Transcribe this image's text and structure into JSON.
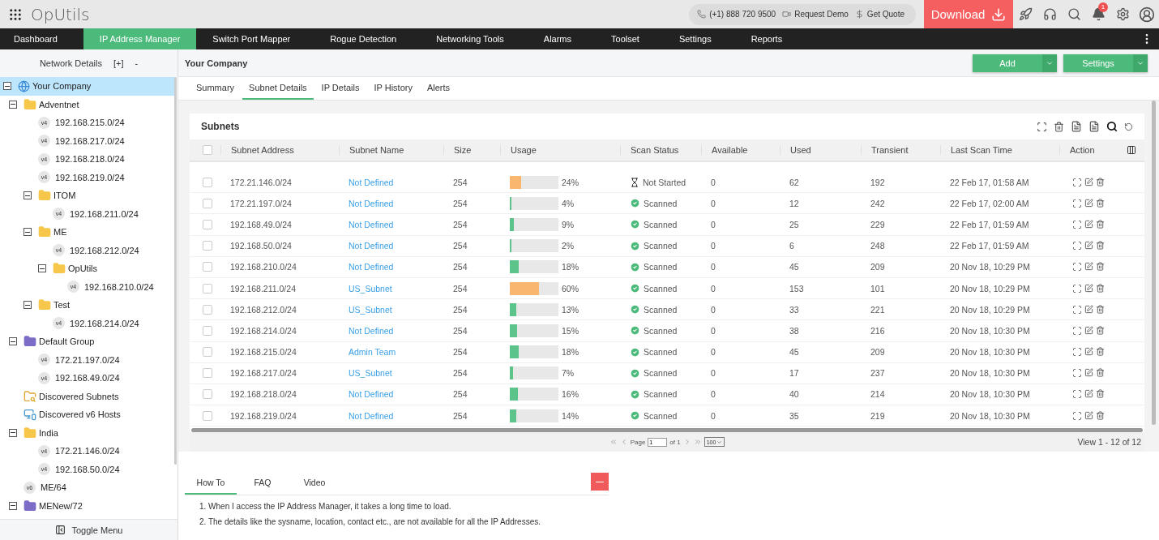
{
  "header": {
    "app_name": "OpUtils",
    "phone": "(+1) 888 720 9500",
    "request_demo": "Request Demo",
    "get_quote": "Get Quote",
    "download": "Download",
    "notifications": "1"
  },
  "nav": {
    "items": [
      {
        "label": "Dashboard",
        "selected": false
      },
      {
        "label": "IP Address Manager",
        "selected": true
      },
      {
        "label": "Switch Port Mapper",
        "selected": false
      },
      {
        "label": "Rogue Detection",
        "selected": false
      },
      {
        "label": "Networking Tools",
        "selected": false
      },
      {
        "label": "Alarms",
        "selected": false
      },
      {
        "label": "Toolset",
        "selected": false
      },
      {
        "label": "Settings",
        "selected": false
      },
      {
        "label": "Reports",
        "selected": false
      }
    ]
  },
  "sidebar": {
    "title": "Network Details",
    "expand_all": "[+]",
    "collapse_all": "-",
    "toggle_menu": "Toggle Menu",
    "tree": [
      {
        "label": "Your Company",
        "kind": "root",
        "expanded": true,
        "selected": true,
        "children": [
          {
            "label": "Adventnet",
            "kind": "folder",
            "color": "#f6c74a",
            "expanded": true,
            "selected": false,
            "children": [
              {
                "label": "192.168.215.0/24",
                "kind": "subnet",
                "badge": "v4",
                "selected": false
              },
              {
                "label": "192.168.217.0/24",
                "kind": "subnet",
                "badge": "v4",
                "selected": false
              },
              {
                "label": "192.168.218.0/24",
                "kind": "subnet",
                "badge": "v4",
                "selected": false
              },
              {
                "label": "192.168.219.0/24",
                "kind": "subnet",
                "badge": "v4",
                "selected": false
              },
              {
                "label": "ITOM",
                "kind": "folder",
                "color": "#f6c74a",
                "expanded": true,
                "selected": false,
                "children": [
                  {
                    "label": "192.168.211.0/24",
                    "kind": "subnet",
                    "badge": "v4",
                    "selected": false
                  }
                ]
              },
              {
                "label": "ME",
                "kind": "folder",
                "color": "#f6c74a",
                "expanded": true,
                "selected": false,
                "children": [
                  {
                    "label": "192.168.212.0/24",
                    "kind": "subnet",
                    "badge": "v4",
                    "selected": false
                  },
                  {
                    "label": "OpUtils",
                    "kind": "folder",
                    "color": "#f6c74a",
                    "expanded": true,
                    "selected": false,
                    "children": [
                      {
                        "label": "192.168.210.0/24",
                        "kind": "subnet",
                        "badge": "v4",
                        "selected": false
                      }
                    ]
                  }
                ]
              },
              {
                "label": "Test",
                "kind": "folder",
                "color": "#f6c74a",
                "expanded": true,
                "selected": false,
                "children": [
                  {
                    "label": "192.168.214.0/24",
                    "kind": "subnet",
                    "badge": "v4",
                    "selected": false
                  }
                ]
              }
            ]
          },
          {
            "label": "Default Group",
            "kind": "folder",
            "color": "#7c6cc6",
            "expanded": true,
            "selected": false,
            "children": [
              {
                "label": "172.21.197.0/24",
                "kind": "subnet",
                "badge": "v4",
                "selected": false
              },
              {
                "label": "192.168.49.0/24",
                "kind": "subnet",
                "badge": "v4",
                "selected": false
              }
            ]
          },
          {
            "label": "Discovered Subnets",
            "kind": "discovery",
            "selected": false
          },
          {
            "label": "Discovered v6 Hosts",
            "kind": "discovery-v6",
            "selected": false
          },
          {
            "label": "India",
            "kind": "folder",
            "color": "#f6c74a",
            "expanded": true,
            "selected": false,
            "children": [
              {
                "label": "172.21.146.0/24",
                "kind": "subnet",
                "badge": "v4",
                "selected": false
              },
              {
                "label": "192.168.50.0/24",
                "kind": "subnet",
                "badge": "v4",
                "selected": false
              }
            ]
          },
          {
            "label": "ME/64",
            "kind": "subnet",
            "badge": "v6",
            "selected": false
          },
          {
            "label": "MENew/72",
            "kind": "folder",
            "color": "#7c6cc6",
            "expanded": true,
            "selected": false
          }
        ]
      }
    ]
  },
  "breadcrumb": "Your Company",
  "actions": {
    "add": "Add",
    "settings": "Settings"
  },
  "tabs": [
    {
      "label": "Summary",
      "selected": false
    },
    {
      "label": "Subnet Details",
      "selected": true
    },
    {
      "label": "IP Details",
      "selected": false
    },
    {
      "label": "IP History",
      "selected": false
    },
    {
      "label": "Alerts",
      "selected": false
    }
  ],
  "table": {
    "title": "Subnets",
    "select_all": {
      "checked": false
    },
    "columns": [
      "Subnet Address",
      "Subnet Name",
      "Size",
      "Usage",
      "Scan Status",
      "Available",
      "Used",
      "Transient",
      "Last Scan Time",
      "Action"
    ],
    "rows": [
      {
        "checked": false,
        "address": "172.21.146.0/24",
        "name": "Not Defined",
        "size": "254",
        "usage": {
          "level": 0.24,
          "text": "24%",
          "color": "#f8b66e"
        },
        "status": {
          "kind": "not-started",
          "text": "Not Started"
        },
        "available": "0",
        "used": "62",
        "transient": "192",
        "last_scan": "22 Feb 17, 01:58 AM"
      },
      {
        "checked": false,
        "address": "172.21.197.0/24",
        "name": "Not Defined",
        "size": "254",
        "usage": {
          "level": 0.04,
          "text": "4%",
          "color": "#5cc38a"
        },
        "status": {
          "kind": "scanned",
          "text": "Scanned"
        },
        "available": "0",
        "used": "12",
        "transient": "242",
        "last_scan": "22 Feb 17, 02:00 AM"
      },
      {
        "checked": false,
        "address": "192.168.49.0/24",
        "name": "Not Defined",
        "size": "254",
        "usage": {
          "level": 0.09,
          "text": "9%",
          "color": "#5cc38a"
        },
        "status": {
          "kind": "scanned",
          "text": "Scanned"
        },
        "available": "0",
        "used": "25",
        "transient": "229",
        "last_scan": "22 Feb 17, 01:59 AM"
      },
      {
        "checked": false,
        "address": "192.168.50.0/24",
        "name": "Not Defined",
        "size": "254",
        "usage": {
          "level": 0.02,
          "text": "2%",
          "color": "#5cc38a"
        },
        "status": {
          "kind": "scanned",
          "text": "Scanned"
        },
        "available": "0",
        "used": "6",
        "transient": "248",
        "last_scan": "22 Feb 17, 01:59 AM"
      },
      {
        "checked": false,
        "address": "192.168.210.0/24",
        "name": "Not Defined",
        "size": "254",
        "usage": {
          "level": 0.18,
          "text": "18%",
          "color": "#5cc38a"
        },
        "status": {
          "kind": "scanned",
          "text": "Scanned"
        },
        "available": "0",
        "used": "45",
        "transient": "209",
        "last_scan": "20 Nov 18, 10:29 PM"
      },
      {
        "checked": false,
        "address": "192.168.211.0/24",
        "name": "US_Subnet",
        "size": "254",
        "usage": {
          "level": 0.6,
          "text": "60%",
          "color": "#f8b66e"
        },
        "status": {
          "kind": "scanned",
          "text": "Scanned"
        },
        "available": "0",
        "used": "153",
        "transient": "101",
        "last_scan": "20 Nov 18, 10:29 PM"
      },
      {
        "checked": false,
        "address": "192.168.212.0/24",
        "name": "US_Subnet",
        "size": "254",
        "usage": {
          "level": 0.13,
          "text": "13%",
          "color": "#5cc38a"
        },
        "status": {
          "kind": "scanned",
          "text": "Scanned"
        },
        "available": "0",
        "used": "33",
        "transient": "221",
        "last_scan": "20 Nov 18, 10:29 PM"
      },
      {
        "checked": false,
        "address": "192.168.214.0/24",
        "name": "Not Defined",
        "size": "254",
        "usage": {
          "level": 0.15,
          "text": "15%",
          "color": "#5cc38a"
        },
        "status": {
          "kind": "scanned",
          "text": "Scanned"
        },
        "available": "0",
        "used": "38",
        "transient": "216",
        "last_scan": "20 Nov 18, 10:30 PM"
      },
      {
        "checked": false,
        "address": "192.168.215.0/24",
        "name": "Admin Team",
        "size": "254",
        "usage": {
          "level": 0.18,
          "text": "18%",
          "color": "#5cc38a"
        },
        "status": {
          "kind": "scanned",
          "text": "Scanned"
        },
        "available": "0",
        "used": "45",
        "transient": "209",
        "last_scan": "20 Nov 18, 10:30 PM"
      },
      {
        "checked": false,
        "address": "192.168.217.0/24",
        "name": "US_Subnet",
        "size": "254",
        "usage": {
          "level": 0.07,
          "text": "7%",
          "color": "#5cc38a"
        },
        "status": {
          "kind": "scanned",
          "text": "Scanned"
        },
        "available": "0",
        "used": "17",
        "transient": "237",
        "last_scan": "20 Nov 18, 10:30 PM"
      },
      {
        "checked": false,
        "address": "192.168.218.0/24",
        "name": "Not Defined",
        "size": "254",
        "usage": {
          "level": 0.16,
          "text": "16%",
          "color": "#5cc38a"
        },
        "status": {
          "kind": "scanned",
          "text": "Scanned"
        },
        "available": "0",
        "used": "40",
        "transient": "214",
        "last_scan": "20 Nov 18, 10:30 PM"
      },
      {
        "checked": false,
        "address": "192.168.219.0/24",
        "name": "Not Defined",
        "size": "254",
        "usage": {
          "level": 0.14,
          "text": "14%",
          "color": "#5cc38a"
        },
        "status": {
          "kind": "scanned",
          "text": "Scanned"
        },
        "available": "0",
        "used": "35",
        "transient": "219",
        "last_scan": "20 Nov 18, 10:30 PM"
      }
    ]
  },
  "pager": {
    "page_label": "Page",
    "page": "1",
    "of": "of 1",
    "page_size": "100",
    "summary": "View 1 - 12 of 12"
  },
  "help": {
    "tabs": [
      {
        "label": "How To",
        "selected": true
      },
      {
        "label": "FAQ",
        "selected": false
      },
      {
        "label": "Video",
        "selected": false
      }
    ],
    "lines": [
      "1. When I access the IP Address Manager, it takes a long time to load.",
      "2. The details like the sysname, location, contact etc., are not available for all the IP Addresses."
    ]
  }
}
